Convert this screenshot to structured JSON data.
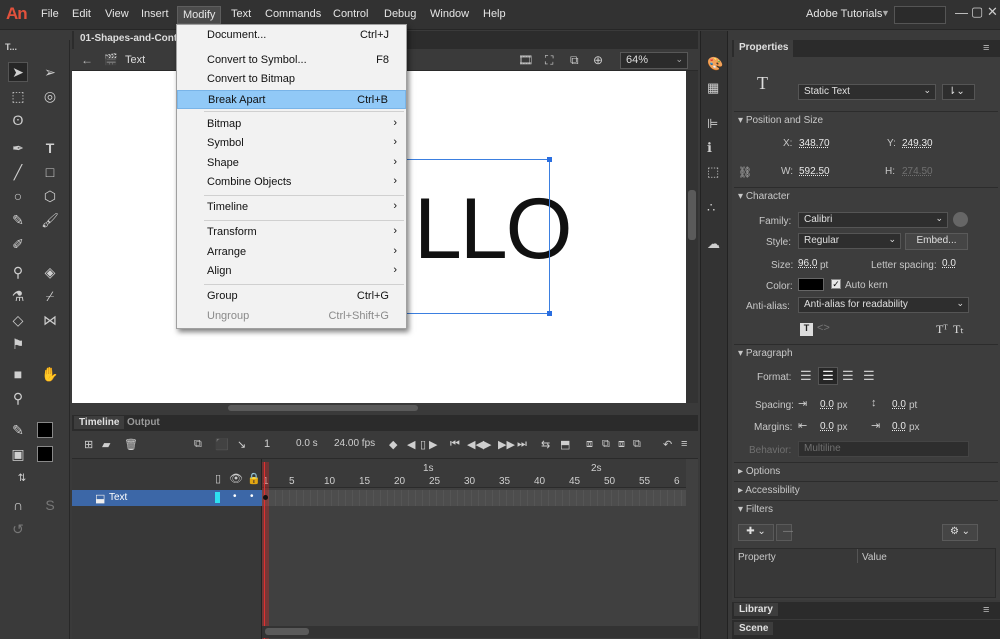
{
  "app": {
    "logo": "An"
  },
  "menubar": {
    "items": [
      "File",
      "Edit",
      "View",
      "Insert",
      "Modify",
      "Text",
      "Commands",
      "Control",
      "Debug",
      "Window",
      "Help"
    ],
    "active": "Modify",
    "workspace": "Adobe Tutorials"
  },
  "document": {
    "tab": "01-Shapes-and-Conta",
    "scene": "Text",
    "zoom": "64%"
  },
  "stage": {
    "text": "LLO"
  },
  "modify_menu": {
    "items": [
      {
        "label": "Document...",
        "shortcut": "Ctrl+J"
      },
      {
        "label": "Convert to Symbol...",
        "shortcut": "F8"
      },
      {
        "label": "Convert to Bitmap",
        "shortcut": ""
      },
      {
        "label": "Break Apart",
        "shortcut": "Ctrl+B"
      },
      {
        "label": "Bitmap",
        "shortcut": ""
      },
      {
        "label": "Symbol",
        "shortcut": ""
      },
      {
        "label": "Shape",
        "shortcut": ""
      },
      {
        "label": "Combine Objects",
        "shortcut": ""
      },
      {
        "label": "Timeline",
        "shortcut": ""
      },
      {
        "label": "Transform",
        "shortcut": ""
      },
      {
        "label": "Arrange",
        "shortcut": ""
      },
      {
        "label": "Align",
        "shortcut": ""
      },
      {
        "label": "Group",
        "shortcut": "Ctrl+G"
      },
      {
        "label": "Ungroup",
        "shortcut": "Ctrl+Shift+G"
      }
    ],
    "highlighted": "Break Apart",
    "submenu_arrow": "›"
  },
  "timeline": {
    "tabs": [
      "Timeline",
      "Output"
    ],
    "frame": "1",
    "time": "0.0 s",
    "fps": "24.00 fps",
    "ruler_labels": [
      "1s",
      "2s"
    ],
    "ruler_ticks": [
      "1",
      "5",
      "10",
      "15",
      "20",
      "25",
      "30",
      "35",
      "40",
      "45",
      "50",
      "55",
      "6"
    ],
    "layer": "Text"
  },
  "properties": {
    "tab": "Properties",
    "text_type": "Static Text",
    "sections": {
      "pos": "Position and Size",
      "char": "Character",
      "para": "Paragraph",
      "options": "Options",
      "access": "Accessibility",
      "filters": "Filters"
    },
    "x_label": "X:",
    "x": "348.70",
    "y_label": "Y:",
    "y": "249.30",
    "w_label": "W:",
    "w": "592.50",
    "h_label": "H:",
    "h": "274.50",
    "family_label": "Family:",
    "family": "Calibri",
    "style_label": "Style:",
    "style": "Regular",
    "embed": "Embed...",
    "size_label": "Size:",
    "size": "96.0",
    "size_unit": "pt",
    "spacing_label": "Letter spacing:",
    "letter_spacing": "0.0",
    "color_label": "Color:",
    "color": "#000000",
    "auto_kern": "Auto kern",
    "aa_label": "Anti-alias:",
    "antialias": "Anti-alias for readability",
    "format_label": "Format:",
    "spacing_p_label": "Spacing:",
    "spacing1": "0.0",
    "spacing2": "0.0",
    "margins_label": "Margins:",
    "margin1": "0.0",
    "margin2": "0.0",
    "px": "px",
    "pt": "pt",
    "behavior_label": "Behavior:",
    "behavior": "Multiline",
    "filter_cols": [
      "Property",
      "Value"
    ]
  },
  "panels": {
    "library": "Library",
    "scene": "Scene"
  },
  "colors": {
    "accent": "#91c9f7",
    "selection": "#3b7fe0",
    "layer": "#3c67a7"
  }
}
